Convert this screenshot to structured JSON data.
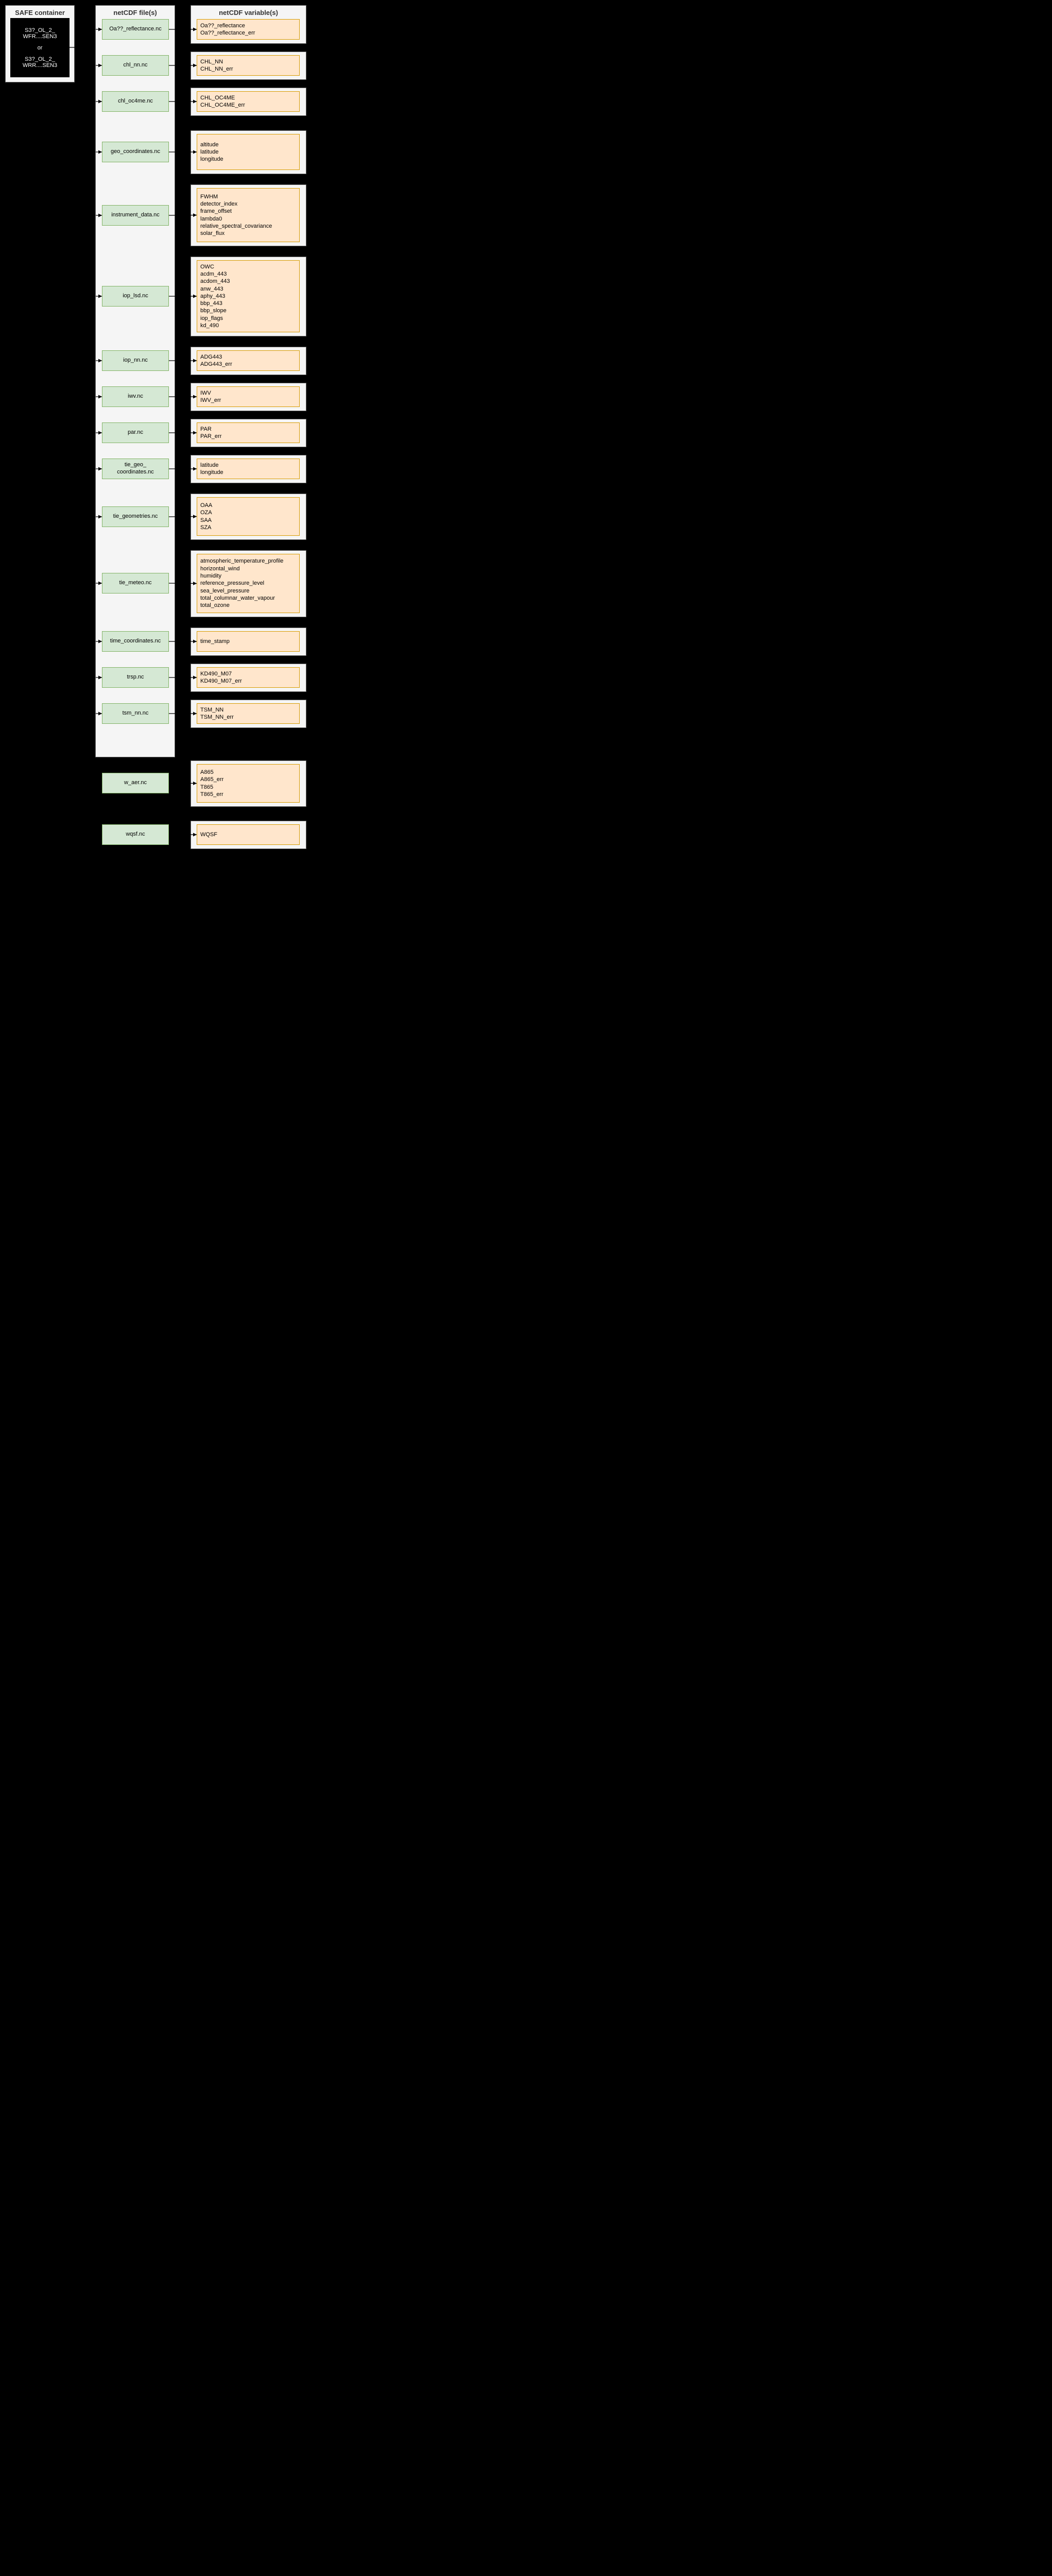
{
  "headers": {
    "safe": "SAFE container",
    "files": "netCDF file(s)",
    "vars": "netCDF variable(s)"
  },
  "safe": {
    "line1": "S3?_OL_2_",
    "line2": "WFR....SEN3",
    "or": "or",
    "line3": "S3?_OL_2_",
    "line4": "WRR....SEN3"
  },
  "rows": [
    {
      "file": "Oa??_reflectance.nc",
      "vars": [
        "Oa??_reflectance",
        "Oa??_reflectance_err"
      ],
      "fTop": 37,
      "fH": 40,
      "vTop": 37,
      "vH": 40,
      "vcH": 55
    },
    {
      "file": "chl_nn.nc",
      "vars": [
        "CHL_NN",
        "CHL_NN_err"
      ],
      "fTop": 107,
      "fH": 40,
      "vTop": 107,
      "vH": 40,
      "vcH": 55
    },
    {
      "file": "chl_oc4me.nc",
      "vars": [
        "CHL_OC4ME",
        "CHL_OC4ME_err"
      ],
      "fTop": 177,
      "fH": 40,
      "vTop": 177,
      "vH": 40,
      "vcH": 55
    },
    {
      "file": "geo_coordinates.nc",
      "vars": [
        "altitude",
        "latitude",
        "longitude"
      ],
      "fTop": 275,
      "fH": 40,
      "vTop": 260,
      "vH": 70,
      "vcH": 85
    },
    {
      "file": "instrument_data.nc",
      "vars": [
        "FWHM",
        "detector_index",
        "frame_offset",
        "lambda0",
        "relative_spectral_covariance",
        "solar_flux"
      ],
      "fTop": 398,
      "fH": 40,
      "vTop": 365,
      "vH": 105,
      "vcH": 120
    },
    {
      "file": "iop_lsd.nc",
      "vars": [
        "OWC",
        "acdm_443",
        "acdom_443",
        "anw_443",
        "aphy_443",
        "bbp_443",
        "bbp_slope",
        "iop_flags",
        "kd_490"
      ],
      "fTop": 555,
      "fH": 40,
      "vTop": 505,
      "vH": 140,
      "vcH": 155
    },
    {
      "file": "iop_nn.nc",
      "vars": [
        "ADG443",
        "ADG443_err"
      ],
      "fTop": 680,
      "fH": 40,
      "vTop": 680,
      "vH": 40,
      "vcH": 55
    },
    {
      "file": "iwv.nc",
      "vars": [
        "IWV",
        "IWV_err"
      ],
      "fTop": 750,
      "fH": 40,
      "vTop": 750,
      "vH": 40,
      "vcH": 55
    },
    {
      "file": "par.nc",
      "vars": [
        "PAR",
        "PAR_err"
      ],
      "fTop": 820,
      "fH": 40,
      "vTop": 820,
      "vH": 40,
      "vcH": 55
    },
    {
      "file": "tie_geo_\ncoordinates.nc",
      "vars": [
        "latitude",
        "longitude"
      ],
      "fTop": 890,
      "fH": 40,
      "vTop": 890,
      "vH": 40,
      "vcH": 55
    },
    {
      "file": "tie_geometries.nc",
      "vars": [
        "OAA",
        "OZA",
        "SAA",
        "SZA"
      ],
      "fTop": 983,
      "fH": 40,
      "vTop": 965,
      "vH": 75,
      "vcH": 90
    },
    {
      "file": "tie_meteo.nc",
      "vars": [
        "atmospheric_temperature_profile",
        "horizontal_wind",
        "humidity",
        "reference_pressure_level",
        "sea_level_pressure",
        "total_columnar_water_vapour",
        "total_ozone"
      ],
      "fTop": 1112,
      "fH": 40,
      "vTop": 1075,
      "vH": 115,
      "vcH": 130
    },
    {
      "file": "time_coordinates.nc",
      "vars": [
        "time_stamp"
      ],
      "fTop": 1225,
      "fH": 40,
      "vTop": 1225,
      "vH": 40,
      "vcH": 55
    },
    {
      "file": "trsp.nc",
      "vars": [
        "KD490_M07",
        "KD490_M07_err"
      ],
      "fTop": 1295,
      "fH": 40,
      "vTop": 1295,
      "vH": 40,
      "vcH": 55
    },
    {
      "file": "tsm_nn.nc",
      "vars": [
        "TSM_NN",
        "TSM_NN_err"
      ],
      "fTop": 1365,
      "fH": 40,
      "vTop": 1365,
      "vH": 40,
      "vcH": 55
    },
    {
      "file": "w_aer.nc",
      "vars": [
        "A865",
        "A865_err",
        "T865",
        "T865_err"
      ],
      "fTop": 1500,
      "fH": 40,
      "vTop": 1483,
      "vH": 75,
      "vcH": 90,
      "loose": true
    },
    {
      "file": "wqsf.nc",
      "vars": [
        "WQSF"
      ],
      "fTop": 1600,
      "fH": 40,
      "vTop": 1600,
      "vH": 40,
      "vcH": 55,
      "loose": true
    }
  ],
  "safeMidY": 92
}
